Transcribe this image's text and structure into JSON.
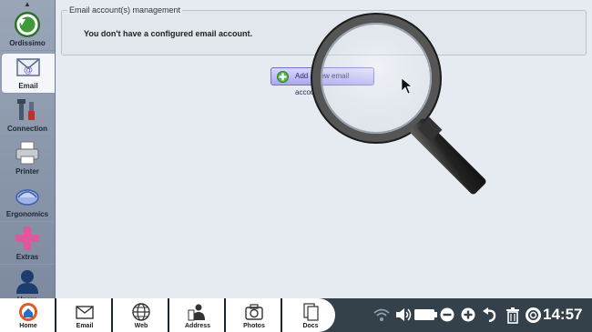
{
  "sidebar": {
    "items": [
      {
        "label": "Ordissimo",
        "icon": "back-arrow-icon"
      },
      {
        "label": "Email",
        "icon": "email-settings-icon"
      },
      {
        "label": "Connection",
        "icon": "connection-tools-icon"
      },
      {
        "label": "Printer",
        "icon": "printer-icon"
      },
      {
        "label": "Ergonomics",
        "icon": "ergonomics-icon"
      },
      {
        "label": "Extras",
        "icon": "extras-plus-icon"
      },
      {
        "label": "Users",
        "icon": "users-icon"
      }
    ],
    "active": "Email"
  },
  "main": {
    "legend": "Email account(s) management",
    "message": "You don't have a configured email account.",
    "add_button_label": "Add a new email account"
  },
  "dock": {
    "items": [
      {
        "label": "Home",
        "icon": "home-icon"
      },
      {
        "label": "Email",
        "icon": "email-icon"
      },
      {
        "label": "Web",
        "icon": "globe-icon"
      },
      {
        "label": "Address",
        "icon": "address-book-icon"
      },
      {
        "label": "Photos",
        "icon": "camera-icon"
      },
      {
        "label": "Docs",
        "icon": "documents-icon"
      }
    ]
  },
  "tray": {
    "icons": [
      "wifi-icon",
      "volume-icon",
      "battery-icon",
      "zoom-out-icon",
      "zoom-in-icon",
      "back-icon",
      "trash-icon",
      "help-icon"
    ],
    "clock": "14:57"
  },
  "colors": {
    "sidebar": "#8592a7",
    "panel": "#e6ebf2",
    "taskbar": "#34404a",
    "button": "#b9b6f5"
  }
}
